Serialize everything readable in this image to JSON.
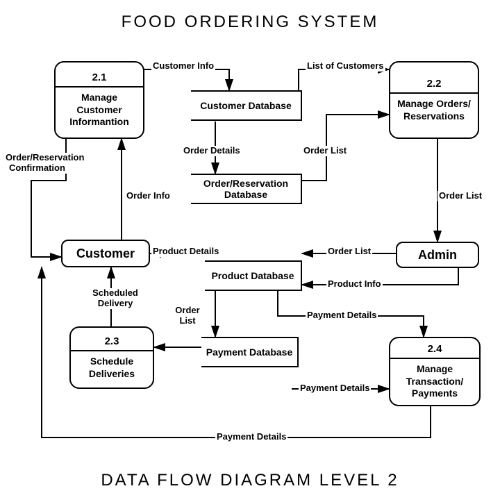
{
  "title": "FOOD ORDERING SYSTEM",
  "subtitle": "DATA FLOW DIAGRAM LEVEL 2",
  "processes": {
    "p21": {
      "num": "2.1",
      "label": "Manage Customer Informantion"
    },
    "p22": {
      "num": "2.2",
      "label": "Manage Orders/ Reservations"
    },
    "p23": {
      "num": "2.3",
      "label": "Schedule Deliveries"
    },
    "p24": {
      "num": "2.4",
      "label": "Manage Transaction/ Payments"
    }
  },
  "entities": {
    "customer": "Customer",
    "admin": "Admin"
  },
  "datastores": {
    "custdb": "Customer Database",
    "orderdb": "Order/Reservation Database",
    "proddb": "Product Database",
    "paydb": "Payment Database"
  },
  "flows": {
    "f1": "Customer Info",
    "f2": "List of Customers",
    "f3": "Order Details",
    "f4": "Order List",
    "f5": "Order List",
    "f6": "Order List",
    "f7": "Product Details",
    "f8": "Product Info",
    "f9": "Payment Details",
    "f10": "Payment Details",
    "f11": "Payment Details",
    "f12": "Order Info",
    "f13": "Order/Reservation Confirmation",
    "f14": "Scheduled Delivery",
    "f15": "Order List"
  }
}
